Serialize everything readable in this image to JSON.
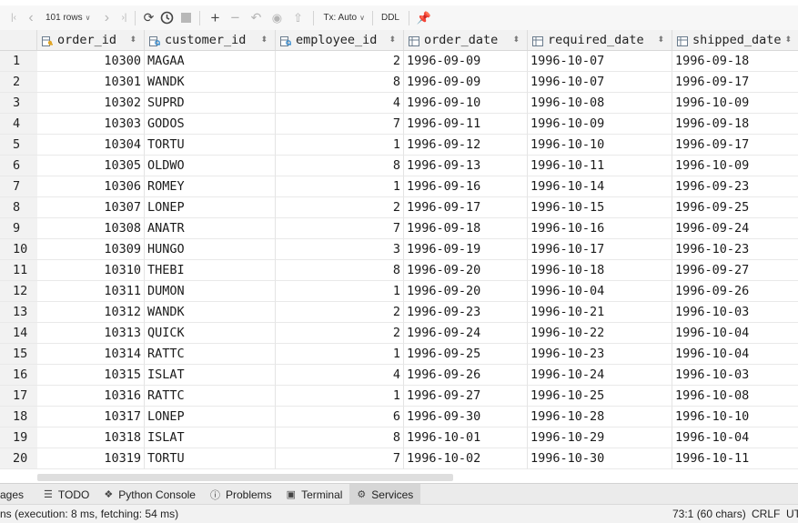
{
  "toolbar": {
    "rows_label": "101 rows",
    "tx_label": "Tx: Auto",
    "ddl_label": "DDL"
  },
  "columns": [
    {
      "name": "order_id",
      "icon": "primary-key-column-icon"
    },
    {
      "name": "customer_id",
      "icon": "foreign-key-column-icon"
    },
    {
      "name": "employee_id",
      "icon": "foreign-key-column-icon"
    },
    {
      "name": "order_date",
      "icon": "column-icon"
    },
    {
      "name": "required_date",
      "icon": "column-icon"
    },
    {
      "name": "shipped_date",
      "icon": "column-icon"
    }
  ],
  "rows": [
    {
      "n": "1",
      "order_id": "10300",
      "customer_id": "MAGAA",
      "employee_id": "2",
      "order_date": "1996-09-09",
      "required_date": "1996-10-07",
      "shipped_date": "1996-09-18"
    },
    {
      "n": "2",
      "order_id": "10301",
      "customer_id": "WANDK",
      "employee_id": "8",
      "order_date": "1996-09-09",
      "required_date": "1996-10-07",
      "shipped_date": "1996-09-17"
    },
    {
      "n": "3",
      "order_id": "10302",
      "customer_id": "SUPRD",
      "employee_id": "4",
      "order_date": "1996-09-10",
      "required_date": "1996-10-08",
      "shipped_date": "1996-10-09"
    },
    {
      "n": "4",
      "order_id": "10303",
      "customer_id": "GODOS",
      "employee_id": "7",
      "order_date": "1996-09-11",
      "required_date": "1996-10-09",
      "shipped_date": "1996-09-18"
    },
    {
      "n": "5",
      "order_id": "10304",
      "customer_id": "TORTU",
      "employee_id": "1",
      "order_date": "1996-09-12",
      "required_date": "1996-10-10",
      "shipped_date": "1996-09-17"
    },
    {
      "n": "6",
      "order_id": "10305",
      "customer_id": "OLDWO",
      "employee_id": "8",
      "order_date": "1996-09-13",
      "required_date": "1996-10-11",
      "shipped_date": "1996-10-09"
    },
    {
      "n": "7",
      "order_id": "10306",
      "customer_id": "ROMEY",
      "employee_id": "1",
      "order_date": "1996-09-16",
      "required_date": "1996-10-14",
      "shipped_date": "1996-09-23"
    },
    {
      "n": "8",
      "order_id": "10307",
      "customer_id": "LONEP",
      "employee_id": "2",
      "order_date": "1996-09-17",
      "required_date": "1996-10-15",
      "shipped_date": "1996-09-25"
    },
    {
      "n": "9",
      "order_id": "10308",
      "customer_id": "ANATR",
      "employee_id": "7",
      "order_date": "1996-09-18",
      "required_date": "1996-10-16",
      "shipped_date": "1996-09-24"
    },
    {
      "n": "10",
      "order_id": "10309",
      "customer_id": "HUNGO",
      "employee_id": "3",
      "order_date": "1996-09-19",
      "required_date": "1996-10-17",
      "shipped_date": "1996-10-23"
    },
    {
      "n": "11",
      "order_id": "10310",
      "customer_id": "THEBI",
      "employee_id": "8",
      "order_date": "1996-09-20",
      "required_date": "1996-10-18",
      "shipped_date": "1996-09-27"
    },
    {
      "n": "12",
      "order_id": "10311",
      "customer_id": "DUMON",
      "employee_id": "1",
      "order_date": "1996-09-20",
      "required_date": "1996-10-04",
      "shipped_date": "1996-09-26"
    },
    {
      "n": "13",
      "order_id": "10312",
      "customer_id": "WANDK",
      "employee_id": "2",
      "order_date": "1996-09-23",
      "required_date": "1996-10-21",
      "shipped_date": "1996-10-03"
    },
    {
      "n": "14",
      "order_id": "10313",
      "customer_id": "QUICK",
      "employee_id": "2",
      "order_date": "1996-09-24",
      "required_date": "1996-10-22",
      "shipped_date": "1996-10-04"
    },
    {
      "n": "15",
      "order_id": "10314",
      "customer_id": "RATTC",
      "employee_id": "1",
      "order_date": "1996-09-25",
      "required_date": "1996-10-23",
      "shipped_date": "1996-10-04"
    },
    {
      "n": "16",
      "order_id": "10315",
      "customer_id": "ISLAT",
      "employee_id": "4",
      "order_date": "1996-09-26",
      "required_date": "1996-10-24",
      "shipped_date": "1996-10-03"
    },
    {
      "n": "17",
      "order_id": "10316",
      "customer_id": "RATTC",
      "employee_id": "1",
      "order_date": "1996-09-27",
      "required_date": "1996-10-25",
      "shipped_date": "1996-10-08"
    },
    {
      "n": "18",
      "order_id": "10317",
      "customer_id": "LONEP",
      "employee_id": "6",
      "order_date": "1996-09-30",
      "required_date": "1996-10-28",
      "shipped_date": "1996-10-10"
    },
    {
      "n": "19",
      "order_id": "10318",
      "customer_id": "ISLAT",
      "employee_id": "8",
      "order_date": "1996-10-01",
      "required_date": "1996-10-29",
      "shipped_date": "1996-10-04"
    },
    {
      "n": "20",
      "order_id": "10319",
      "customer_id": "TORTU",
      "employee_id": "7",
      "order_date": "1996-10-02",
      "required_date": "1996-10-30",
      "shipped_date": "1996-10-11"
    }
  ],
  "bottom_tabs": [
    {
      "label": "ages",
      "icon": ""
    },
    {
      "label": "TODO",
      "icon": "todo-list-icon"
    },
    {
      "label": "Python Console",
      "icon": "python-console-icon"
    },
    {
      "label": "Problems",
      "icon": "problems-icon"
    },
    {
      "label": "Terminal",
      "icon": "terminal-icon"
    },
    {
      "label": "Services",
      "icon": "services-icon"
    }
  ],
  "status": {
    "message": "ns (execution: 8 ms, fetching: 54 ms)",
    "position": "73:1 (60 chars)",
    "line_ending": "CRLF",
    "encoding": "UT"
  },
  "colors": {
    "accent": "#3574f0",
    "header_bg": "#f2f2f2",
    "active_tab": "#d6d6d6"
  }
}
